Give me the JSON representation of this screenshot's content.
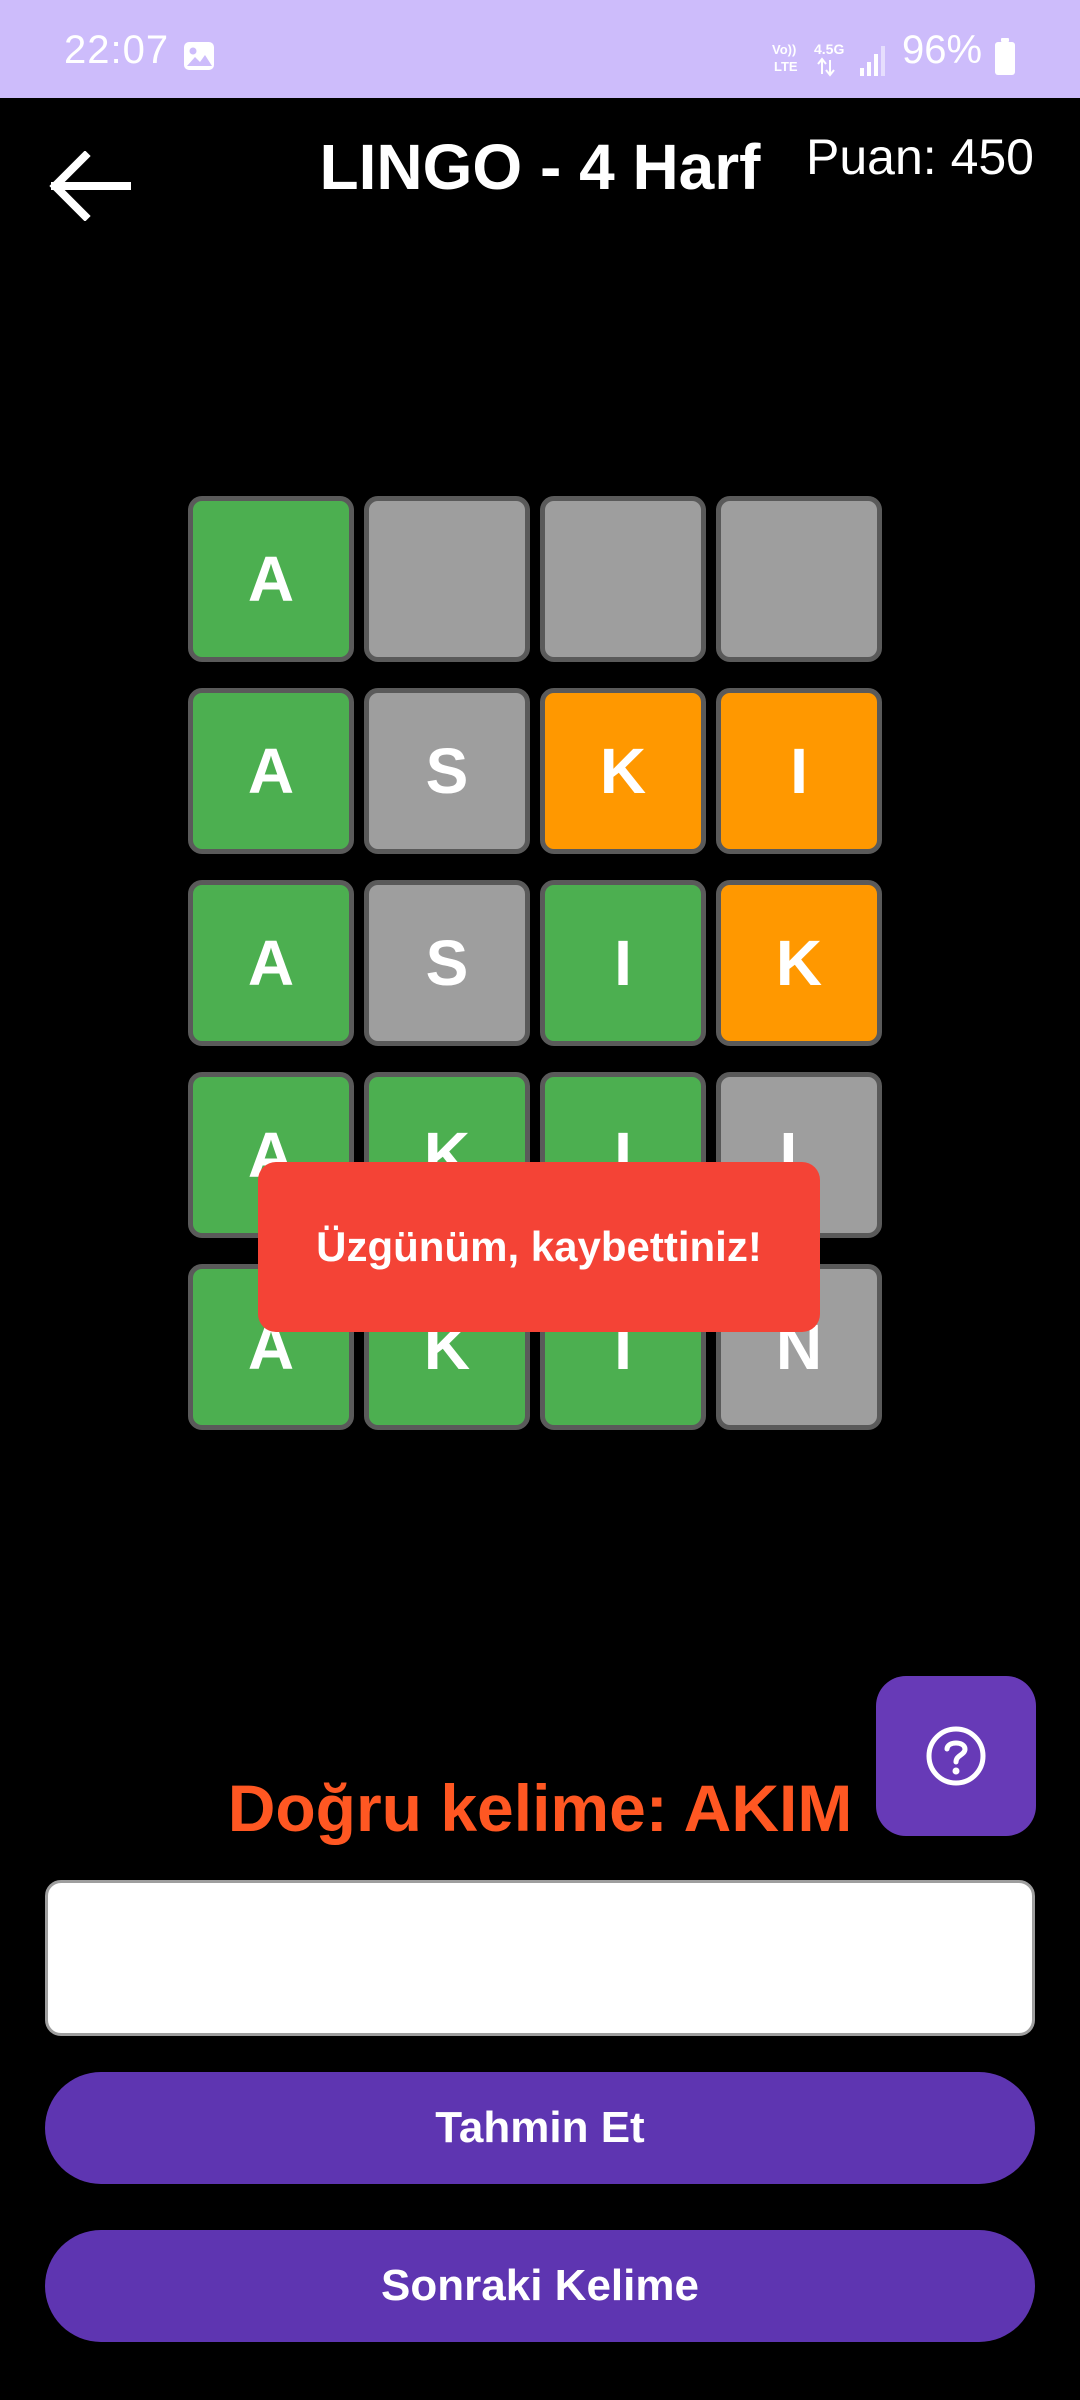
{
  "status_bar": {
    "time": "22:07",
    "battery": "96%",
    "icons": [
      "gallery-icon",
      "volte-icon",
      "4.5g-icon",
      "signal-icon",
      "battery-icon"
    ],
    "lte_label": "Vo)) LTE",
    "net_label": "4.5G"
  },
  "header": {
    "title": "LINGO - 4 Harf",
    "score": "Puan: 450",
    "back_icon": "arrow-left-icon"
  },
  "grid": {
    "rows": [
      [
        {
          "letter": "A",
          "state": "green"
        },
        {
          "letter": "",
          "state": "gray"
        },
        {
          "letter": "",
          "state": "gray"
        },
        {
          "letter": "",
          "state": "gray"
        }
      ],
      [
        {
          "letter": "A",
          "state": "green"
        },
        {
          "letter": "S",
          "state": "gray"
        },
        {
          "letter": "K",
          "state": "orange"
        },
        {
          "letter": "I",
          "state": "orange"
        }
      ],
      [
        {
          "letter": "A",
          "state": "green"
        },
        {
          "letter": "S",
          "state": "gray"
        },
        {
          "letter": "I",
          "state": "green"
        },
        {
          "letter": "K",
          "state": "orange"
        }
      ],
      [
        {
          "letter": "A",
          "state": "green"
        },
        {
          "letter": "K",
          "state": "green"
        },
        {
          "letter": "I",
          "state": "green"
        },
        {
          "letter": "L",
          "state": "gray"
        }
      ],
      [
        {
          "letter": "A",
          "state": "green"
        },
        {
          "letter": "K",
          "state": "green"
        },
        {
          "letter": "I",
          "state": "green"
        },
        {
          "letter": "N",
          "state": "gray"
        }
      ]
    ]
  },
  "toast": {
    "message": "Üzgünüm, kaybettiniz!"
  },
  "answer": {
    "text": "Doğru kelime: AKIM"
  },
  "input": {
    "value": "",
    "placeholder": ""
  },
  "buttons": {
    "guess_label": "Tahmin Et",
    "next_label": "Sonraki Kelime",
    "help_icon": "question-circle-icon"
  },
  "colors": {
    "status_bar": "#cdbcfb",
    "correct": "#4caf50",
    "present": "#ff9800",
    "absent": "#9e9e9e",
    "toast": "#f44336",
    "answer_text": "#ff5722",
    "primary_button": "#5e35b1",
    "help_button": "#673ab7"
  }
}
